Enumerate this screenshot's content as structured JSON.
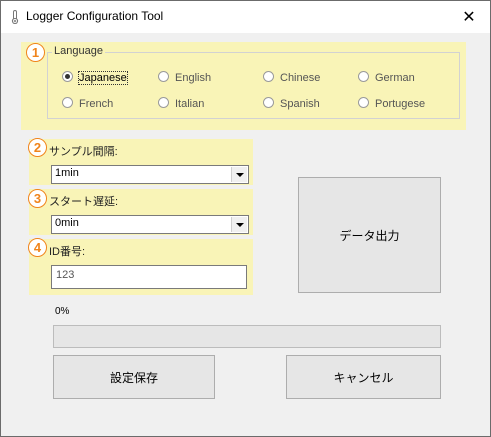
{
  "window": {
    "title": "Logger Configuration Tool",
    "close_glyph": "✕",
    "icon": "thermometer-icon"
  },
  "language_group": {
    "badge": "1",
    "label": "Language",
    "options": [
      "Japanese",
      "English",
      "Chinese",
      "German",
      "French",
      "Italian",
      "Spanish",
      "Portugese"
    ],
    "selected": "Japanese"
  },
  "sample_interval": {
    "badge": "2",
    "label": "サンプル間隔:",
    "value": "1min"
  },
  "start_delay": {
    "badge": "3",
    "label": "スタート遅延:",
    "value": "0min"
  },
  "id_field": {
    "badge": "4",
    "label": "ID番号:",
    "value": "123"
  },
  "buttons": {
    "data_output": "データ出力",
    "save_settings": "設定保存",
    "cancel": "キャンセル"
  },
  "progress": {
    "label": "0%",
    "value": 0
  },
  "colors": {
    "highlight": "#f9f4b7",
    "badge": "#f0841b"
  }
}
